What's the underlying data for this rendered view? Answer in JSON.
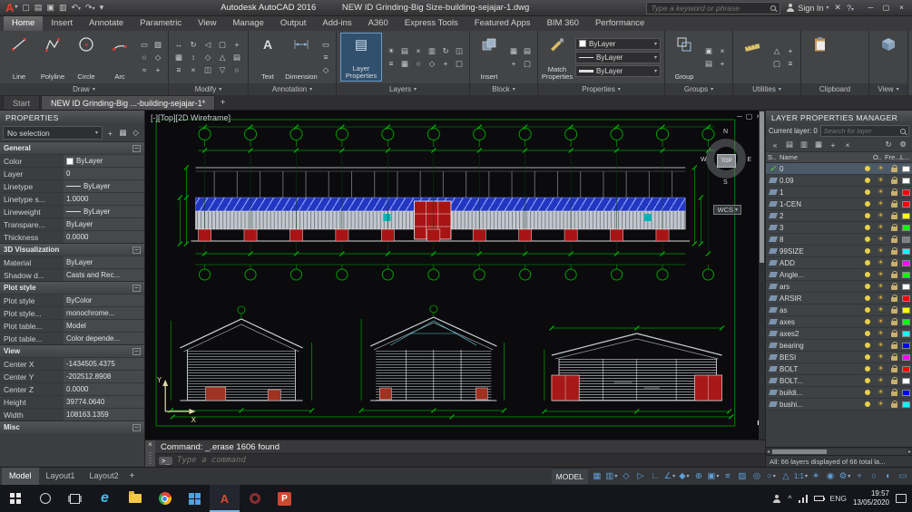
{
  "titlebar": {
    "app": "Autodesk AutoCAD 2016",
    "doc": "NEW ID Grinding-Big Size-building-sejajar-1.dwg",
    "search_placeholder": "Type a keyword or phrase",
    "signin": "Sign In",
    "qat_icons": [
      {
        "name": "new-file-icon",
        "glyph": "▢"
      },
      {
        "name": "open-file-icon",
        "glyph": "▤"
      },
      {
        "name": "save-file-icon",
        "glyph": "▣"
      },
      {
        "name": "plot-icon",
        "glyph": "▥"
      },
      {
        "name": "undo-icon",
        "glyph": "↶",
        "caret": true
      },
      {
        "name": "redo-icon",
        "glyph": "↷",
        "caret": true
      },
      {
        "name": "qat-customize-icon",
        "glyph": "▾"
      }
    ]
  },
  "ribbon": {
    "tabs": [
      "Home",
      "Insert",
      "Annotate",
      "Parametric",
      "View",
      "Manage",
      "Output",
      "Add-ins",
      "A360",
      "Express Tools",
      "Featured Apps",
      "BIM 360",
      "Performance"
    ],
    "active_tab": "Home",
    "panels": {
      "draw": {
        "label": "Draw",
        "tools": [
          "Line",
          "Polyline",
          "Circle",
          "Arc"
        ],
        "extra_icons": [
          "▭",
          "▧",
          "○",
          "◇",
          "≈",
          "+"
        ]
      },
      "modify": {
        "label": "Modify",
        "icons": [
          "↔",
          "↻",
          "◁",
          "▢",
          "+",
          "▦",
          "↕",
          "◇",
          "△",
          "▤",
          "≡",
          "×",
          "◫",
          "▽",
          "○"
        ]
      },
      "annotation": {
        "label": "Annotation",
        "tools": [
          "Text",
          "Dimension"
        ],
        "icons": [
          "▭",
          "≡",
          "◇"
        ]
      },
      "layers": {
        "label": "Layers",
        "tool": "Layer Properties",
        "icons": [
          "☀",
          "▤",
          "×",
          "▥",
          "↻",
          "◫",
          "≡",
          "▦",
          "○",
          "◇",
          "+",
          "▢"
        ]
      },
      "block": {
        "label": "Block",
        "tool": "Insert",
        "icons": [
          "▦",
          "▤",
          "+",
          "▢"
        ]
      },
      "properties": {
        "label": "Properties",
        "tool": "Match Properties",
        "dropdowns": [
          "ByLayer",
          "ByLayer",
          "ByLayer"
        ]
      },
      "groups": {
        "label": "Groups",
        "tool": "Group",
        "icons": [
          "▣",
          "×",
          "▤",
          "+"
        ]
      },
      "utilities": {
        "label": "Utilities",
        "icons": [
          "△",
          "+",
          "▢",
          "≡"
        ]
      },
      "clipboard": {
        "label": "Clipboard"
      },
      "view": {
        "label": "View"
      }
    }
  },
  "file_tabs": {
    "start_label": "Start",
    "active_doc": "NEW ID Grinding-Big ...-building-sejajar-1*",
    "new_tab": "+"
  },
  "properties_palette": {
    "title": "PROPERTIES",
    "selection": "No selection",
    "sel_icons": [
      {
        "name": "toggle-pickadd-icon",
        "glyph": "+"
      },
      {
        "name": "quick-select-icon",
        "glyph": "▦"
      },
      {
        "name": "select-objects-icon",
        "glyph": "◇"
      }
    ],
    "sections": [
      {
        "name": "General",
        "rows": [
          {
            "label": "Color",
            "value": "ByLayer",
            "chip": "#ffffff"
          },
          {
            "label": "Layer",
            "value": "0"
          },
          {
            "label": "Linetype",
            "value": "ByLayer",
            "line": true
          },
          {
            "label": "Linetype s...",
            "value": "1.0000"
          },
          {
            "label": "Lineweight",
            "value": "ByLayer",
            "line": true
          },
          {
            "label": "Transpare...",
            "value": "ByLayer"
          },
          {
            "label": "Thickness",
            "value": "0.0000"
          }
        ]
      },
      {
        "name": "3D Visualization",
        "rows": [
          {
            "label": "Material",
            "value": "ByLayer"
          },
          {
            "label": "Shadow d...",
            "value": "Casts and Rec..."
          }
        ]
      },
      {
        "name": "Plot style",
        "rows": [
          {
            "label": "Plot style",
            "value": "ByColor"
          },
          {
            "label": "Plot style...",
            "value": "monochrome..."
          },
          {
            "label": "Plot table...",
            "value": "Model"
          },
          {
            "label": "Plot table...",
            "value": "Color depende..."
          }
        ]
      },
      {
        "name": "View",
        "rows": [
          {
            "label": "Center X",
            "value": "-1434505.4375"
          },
          {
            "label": "Center Y",
            "value": "-202512.8908"
          },
          {
            "label": "Center Z",
            "value": "0.0000"
          },
          {
            "label": "Height",
            "value": "39774.0640"
          },
          {
            "label": "Width",
            "value": "108163.1359"
          }
        ]
      },
      {
        "name": "Misc",
        "rows": []
      }
    ]
  },
  "viewport": {
    "label": "[-][Top][2D Wireframe]",
    "wcs_label": "WCS",
    "viewcube": {
      "n": "N",
      "w": "W",
      "e": "E",
      "s": "S",
      "top": "TOP"
    }
  },
  "layer_manager": {
    "title": "LAYER PROPERTIES MANAGER",
    "current_label": "Current layer: 0",
    "search_placeholder": "Search for layer",
    "columns": [
      "S..",
      "Name",
      "O..",
      "Fre...",
      "L..."
    ],
    "tool_icons": [
      {
        "name": "collapse-filters-icon",
        "glyph": "«"
      },
      {
        "name": "new-property-filter-icon",
        "glyph": "▤"
      },
      {
        "name": "new-group-filter-icon",
        "glyph": "▥"
      },
      {
        "name": "layer-states-icon",
        "glyph": "▦"
      },
      {
        "name": "new-layer-icon",
        "glyph": "+"
      },
      {
        "name": "delete-layer-icon",
        "glyph": "×"
      }
    ],
    "tool_icons_right": [
      {
        "name": "refresh-icon",
        "glyph": "↻"
      },
      {
        "name": "settings-gear-icon",
        "glyph": "⚙"
      }
    ],
    "layers": [
      {
        "name": "0",
        "color": "#ffffff",
        "current": true
      },
      {
        "name": "0.09",
        "color": "#ffffff"
      },
      {
        "name": "1",
        "color": "#ff0000"
      },
      {
        "name": "1-CEN",
        "color": "#ff0000"
      },
      {
        "name": "2",
        "color": "#ffff00"
      },
      {
        "name": "3",
        "color": "#00ff00"
      },
      {
        "name": "8",
        "color": "#808080"
      },
      {
        "name": "99SIZE",
        "color": "#00ffff"
      },
      {
        "name": "ADD",
        "color": "#ff00ff"
      },
      {
        "name": "Angle...",
        "color": "#00ff00"
      },
      {
        "name": "ars",
        "color": "#ffffff"
      },
      {
        "name": "ARSIR",
        "color": "#ff0000"
      },
      {
        "name": "as",
        "color": "#ffff00"
      },
      {
        "name": "axes",
        "color": "#00ff00"
      },
      {
        "name": "axes2",
        "color": "#00ffff"
      },
      {
        "name": "bearing",
        "color": "#0000ff"
      },
      {
        "name": "BESI",
        "color": "#ff00ff"
      },
      {
        "name": "BOLT",
        "color": "#ff0000"
      },
      {
        "name": "BOLT...",
        "color": "#ffffff"
      },
      {
        "name": "buildi...",
        "color": "#0000ff"
      },
      {
        "name": "bushi...",
        "color": "#00ffff"
      }
    ],
    "status_text": "All: 66 layers displayed of 66 total la..."
  },
  "command": {
    "history": "Command: _.erase 1606 found",
    "input_placeholder": "Type a command"
  },
  "status_bar": {
    "layout_tabs": [
      "Model",
      "Layout1",
      "Layout2"
    ],
    "active_layout": "Model",
    "new_layout_label": "+",
    "model_label": "MODEL",
    "icons": [
      {
        "name": "grid-display-icon",
        "glyph": "▦"
      },
      {
        "name": "snap-mode-icon",
        "glyph": "▥",
        "caret": true
      },
      {
        "name": "infer-constraints-icon",
        "glyph": "◇"
      },
      {
        "name": "dynamic-input-icon",
        "glyph": "▷"
      },
      {
        "name": "ortho-mode-icon",
        "glyph": "∟"
      },
      {
        "name": "polar-tracking-icon",
        "glyph": "∠",
        "caret": true
      },
      {
        "name": "isometric-drafting-icon",
        "glyph": "◆",
        "caret": true
      },
      {
        "name": "osnap-tracking-icon",
        "glyph": "⊕"
      },
      {
        "name": "object-snap-icon",
        "glyph": "▣",
        "caret": true
      },
      {
        "name": "lineweight-icon",
        "glyph": "≡"
      },
      {
        "name": "transparency-icon",
        "glyph": "▨"
      },
      {
        "name": "selection-cycling-icon",
        "glyph": "◎"
      },
      {
        "name": "3d-osnap-icon",
        "glyph": "○",
        "caret": true
      },
      {
        "name": "dynamic-ucs-icon",
        "glyph": "△"
      },
      {
        "name": "annotation-scale-button",
        "text": "1:1",
        "caret": true
      },
      {
        "name": "annotation-visibility-icon",
        "glyph": "☀"
      },
      {
        "name": "autoscale-icon",
        "glyph": "◉"
      },
      {
        "name": "workspace-switching-icon",
        "glyph": "⚙",
        "caret": true
      },
      {
        "name": "annotation-monitor-icon",
        "glyph": "+"
      },
      {
        "name": "isolate-objects-icon",
        "glyph": "○"
      },
      {
        "name": "graphics-performance-icon",
        "glyph": "◐"
      },
      {
        "name": "clean-screen-icon",
        "glyph": "▭"
      }
    ]
  },
  "taskbar": {
    "items": [
      {
        "name": "start-button",
        "cls": "win"
      },
      {
        "name": "search-button",
        "cls": "cortana"
      },
      {
        "name": "task-view-button",
        "cls": "taskview"
      },
      {
        "name": "edge-icon",
        "cls": "edge",
        "glyph": "e"
      },
      {
        "name": "file-explorer-icon",
        "cls": "folder"
      },
      {
        "name": "chrome-icon",
        "cls": "chrome"
      },
      {
        "name": "blue-tiles-icon",
        "cls": "tiles"
      },
      {
        "name": "autocad-taskbar-icon",
        "cls": "acad active",
        "glyph": "A"
      },
      {
        "name": "browser-ring-icon",
        "cls": "ring"
      },
      {
        "name": "powerpoint-icon",
        "cls": "ppt",
        "glyph": "P"
      }
    ],
    "tray": {
      "language": "ENG",
      "time": "19:57",
      "date": "13/05/2020"
    }
  }
}
